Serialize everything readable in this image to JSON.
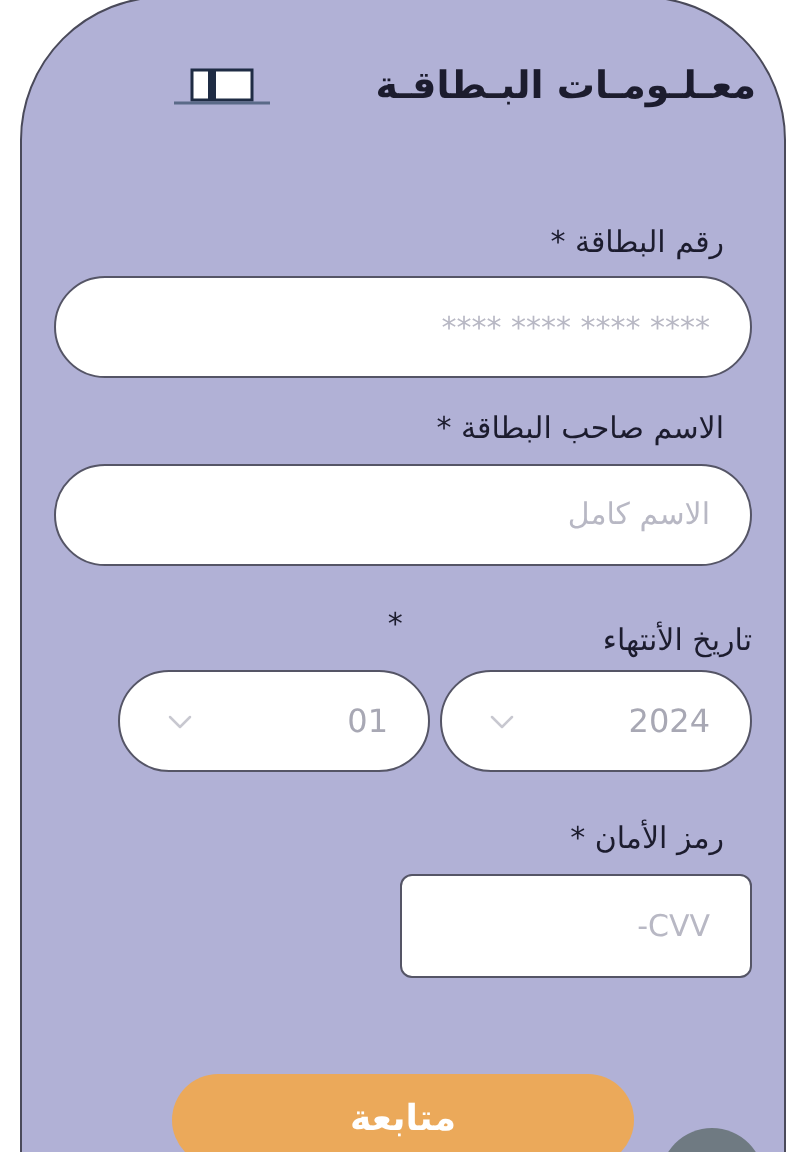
{
  "title": "معـلـومـات البـطاقـة",
  "card_number": {
    "label": "رقم البطاقة *",
    "placeholder": "**** **** **** ****"
  },
  "holder_name": {
    "label": "الاسم صاحب البطاقة *",
    "placeholder": "الاسم كامل"
  },
  "expiry": {
    "label": "تاريخ الأنتهاء",
    "required_mark": "*",
    "year": "2024",
    "month": "01"
  },
  "cvv": {
    "label": "رمز الأمان *",
    "placeholder": "-CVV"
  },
  "button": {
    "label": "متابعة"
  }
}
